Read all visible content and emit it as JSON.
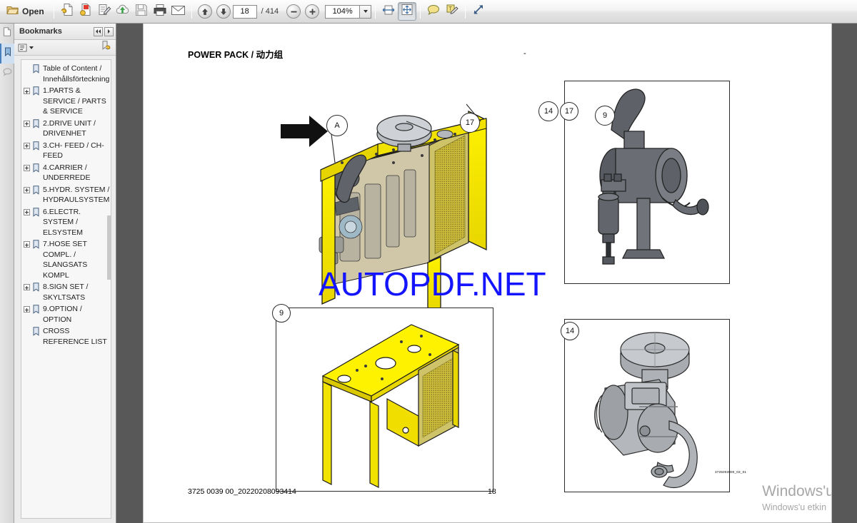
{
  "toolbar": {
    "open_label": "Open",
    "icons": [
      {
        "name": "open-folder-icon"
      },
      {
        "name": "create-pdf-icon"
      },
      {
        "name": "combine-files-icon"
      },
      {
        "name": "edit-pdf-icon"
      },
      {
        "name": "upload-cloud-icon"
      },
      {
        "name": "save-icon"
      },
      {
        "name": "print-icon"
      },
      {
        "name": "email-icon"
      },
      {
        "name": "previous-page-icon"
      },
      {
        "name": "next-page-icon"
      },
      {
        "name": "zoom-out-icon"
      },
      {
        "name": "zoom-in-icon"
      },
      {
        "name": "fit-width-icon"
      },
      {
        "name": "fit-page-icon"
      },
      {
        "name": "sticky-note-icon"
      },
      {
        "name": "highlight-text-icon"
      },
      {
        "name": "fullscreen-icon"
      }
    ],
    "page_number": "18",
    "page_total": "/ 414",
    "zoom_level": "104%"
  },
  "vtabs": [
    {
      "name": "page-thumbnails-tab",
      "active": false
    },
    {
      "name": "bookmarks-tab",
      "active": true
    },
    {
      "name": "comments-tab",
      "active": false
    }
  ],
  "bookmarks_panel": {
    "title": "Bookmarks",
    "collapse_label": "◀◀",
    "expand_label": "▶",
    "options_label": "▾",
    "items": [
      {
        "label": "Table of Content / Innehållsförteckning",
        "expandable": false
      },
      {
        "label": "1.PARTS & SERVICE / PARTS & SERVICE",
        "expandable": true
      },
      {
        "label": "2.DRIVE UNIT / DRIVENHET",
        "expandable": true
      },
      {
        "label": "3.CH- FEED / CH-FEED",
        "expandable": true
      },
      {
        "label": "4.CARRIER / UNDERREDE",
        "expandable": true
      },
      {
        "label": "5.HYDR. SYSTEM / HYDRAULSYSTEM",
        "expandable": true
      },
      {
        "label": "6.ELECTR. SYSTEM / ELSYSTEM",
        "expandable": true
      },
      {
        "label": "7.HOSE SET COMPL. / SLANGSATS KOMPL",
        "expandable": true
      },
      {
        "label": "8.SIGN SET / SKYLTSATS",
        "expandable": true
      },
      {
        "label": "9.OPTION / OPTION",
        "expandable": true
      },
      {
        "label": "CROSS REFERENCE LIST",
        "expandable": false
      }
    ]
  },
  "document": {
    "title": "POWER PACK / 动力组",
    "title_right_mark": "-",
    "footer_left": "3725 0039 00_20220208093414",
    "footer_page": "18",
    "drawing_code": "3725003900_03_01",
    "site_watermark": "AUTOPDF.NET",
    "balloons": {
      "section_a": "A",
      "main_17": "17",
      "main_14": "14",
      "main_9": "9",
      "detail_17": "17",
      "detail_9": "9",
      "detail_14": "14"
    }
  },
  "windows_watermark": {
    "line1": "Windows'u ",
    "line2": "Windows'u etkin"
  },
  "colors": {
    "machine_yellow": "#f5e400",
    "machine_yellow_shade": "#d7c400",
    "metal_gray": "#6d7175",
    "metal_light": "#b9bcc0",
    "watermark_blue": "#1414ff",
    "line_black": "#1a1a1a"
  }
}
